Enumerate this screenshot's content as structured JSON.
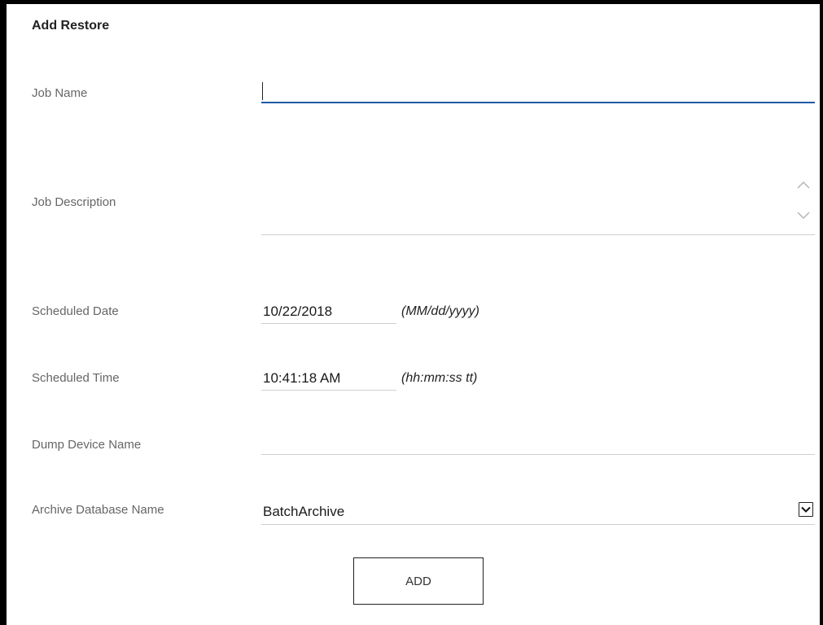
{
  "form": {
    "title": "Add Restore",
    "job_name": {
      "label": "Job Name",
      "value": ""
    },
    "job_description": {
      "label": "Job Description",
      "value": ""
    },
    "scheduled_date": {
      "label": "Scheduled Date",
      "value": "10/22/2018",
      "format_hint": "(MM/dd/yyyy)"
    },
    "scheduled_time": {
      "label": "Scheduled Time",
      "value": "10:41:18 AM",
      "format_hint": "(hh:mm:ss tt)"
    },
    "dump_device_name": {
      "label": "Dump Device Name",
      "value": ""
    },
    "archive_database_name": {
      "label": "Archive Database Name",
      "selected": "BatchArchive"
    },
    "add_button_label": "ADD"
  },
  "colors": {
    "focus_underline": "#1f5aa6",
    "field_underline": "#d0d0d0",
    "label_text": "#666666"
  },
  "icons": {
    "scroll_up": "chevron-up-icon",
    "scroll_down": "chevron-down-icon",
    "dropdown": "chevron-down-icon"
  }
}
